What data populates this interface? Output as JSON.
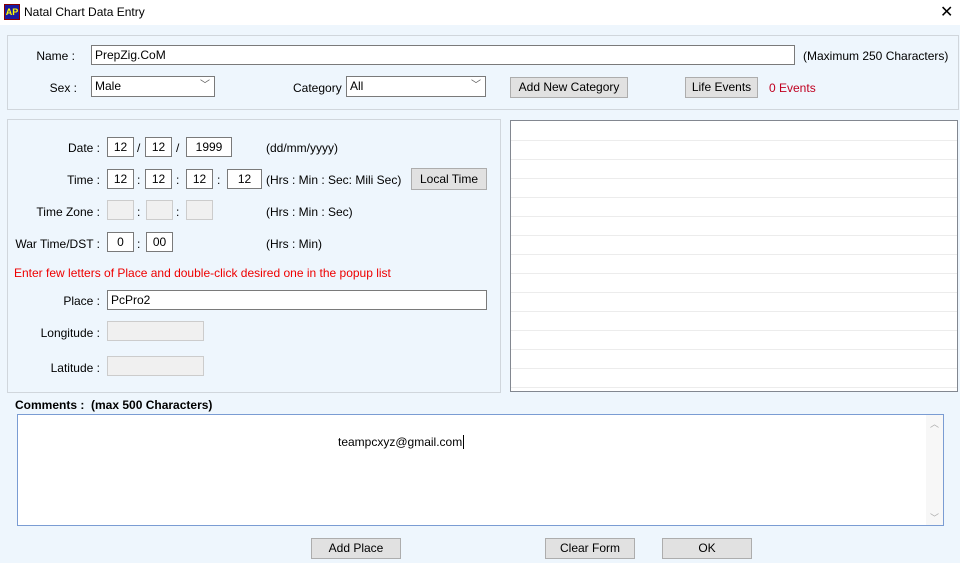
{
  "window": {
    "title": "Natal Chart Data Entry",
    "close": "✕",
    "icon": "AP"
  },
  "identity": {
    "name_label": "Name :",
    "name_value": "PrepZig.CoM",
    "name_hint": "(Maximum 250 Characters)",
    "sex_label": "Sex :",
    "sex_value": "Male",
    "category_label": "Category",
    "category_value": "All",
    "add_category": "Add New Category",
    "life_events": "Life Events",
    "events_count": "0 Events"
  },
  "datetime": {
    "date_label": "Date :",
    "day": "12",
    "month": "12",
    "year": "1999",
    "date_hint": "(dd/mm/yyyy)",
    "sep_slash": "/",
    "sep_colon": ":",
    "time_label": "Time :",
    "hrs": "12",
    "min": "12",
    "sec": "12",
    "ms": "12",
    "time_hint": "(Hrs : Min : Sec: Mili Sec)",
    "local_time": "Local Time",
    "tz_label": "Time Zone :",
    "tz_hint": "(Hrs : Min : Sec)",
    "dst_label": "War Time/DST :",
    "dst_hrs": "0",
    "dst_min": "00",
    "dst_hint": "(Hrs : Min)",
    "place_hint": "Enter few letters of Place and double-click desired one in the popup list",
    "place_label": "Place :",
    "place_value": "PcPro2",
    "longitude_label": "Longitude :",
    "latitude_label": "Latitude :"
  },
  "comments": {
    "label": "Comments :  (max 500 Characters)",
    "value": "teampcxyz@gmail.com"
  },
  "footer": {
    "add_place": "Add Place",
    "clear_form": "Clear Form",
    "ok": "OK"
  }
}
